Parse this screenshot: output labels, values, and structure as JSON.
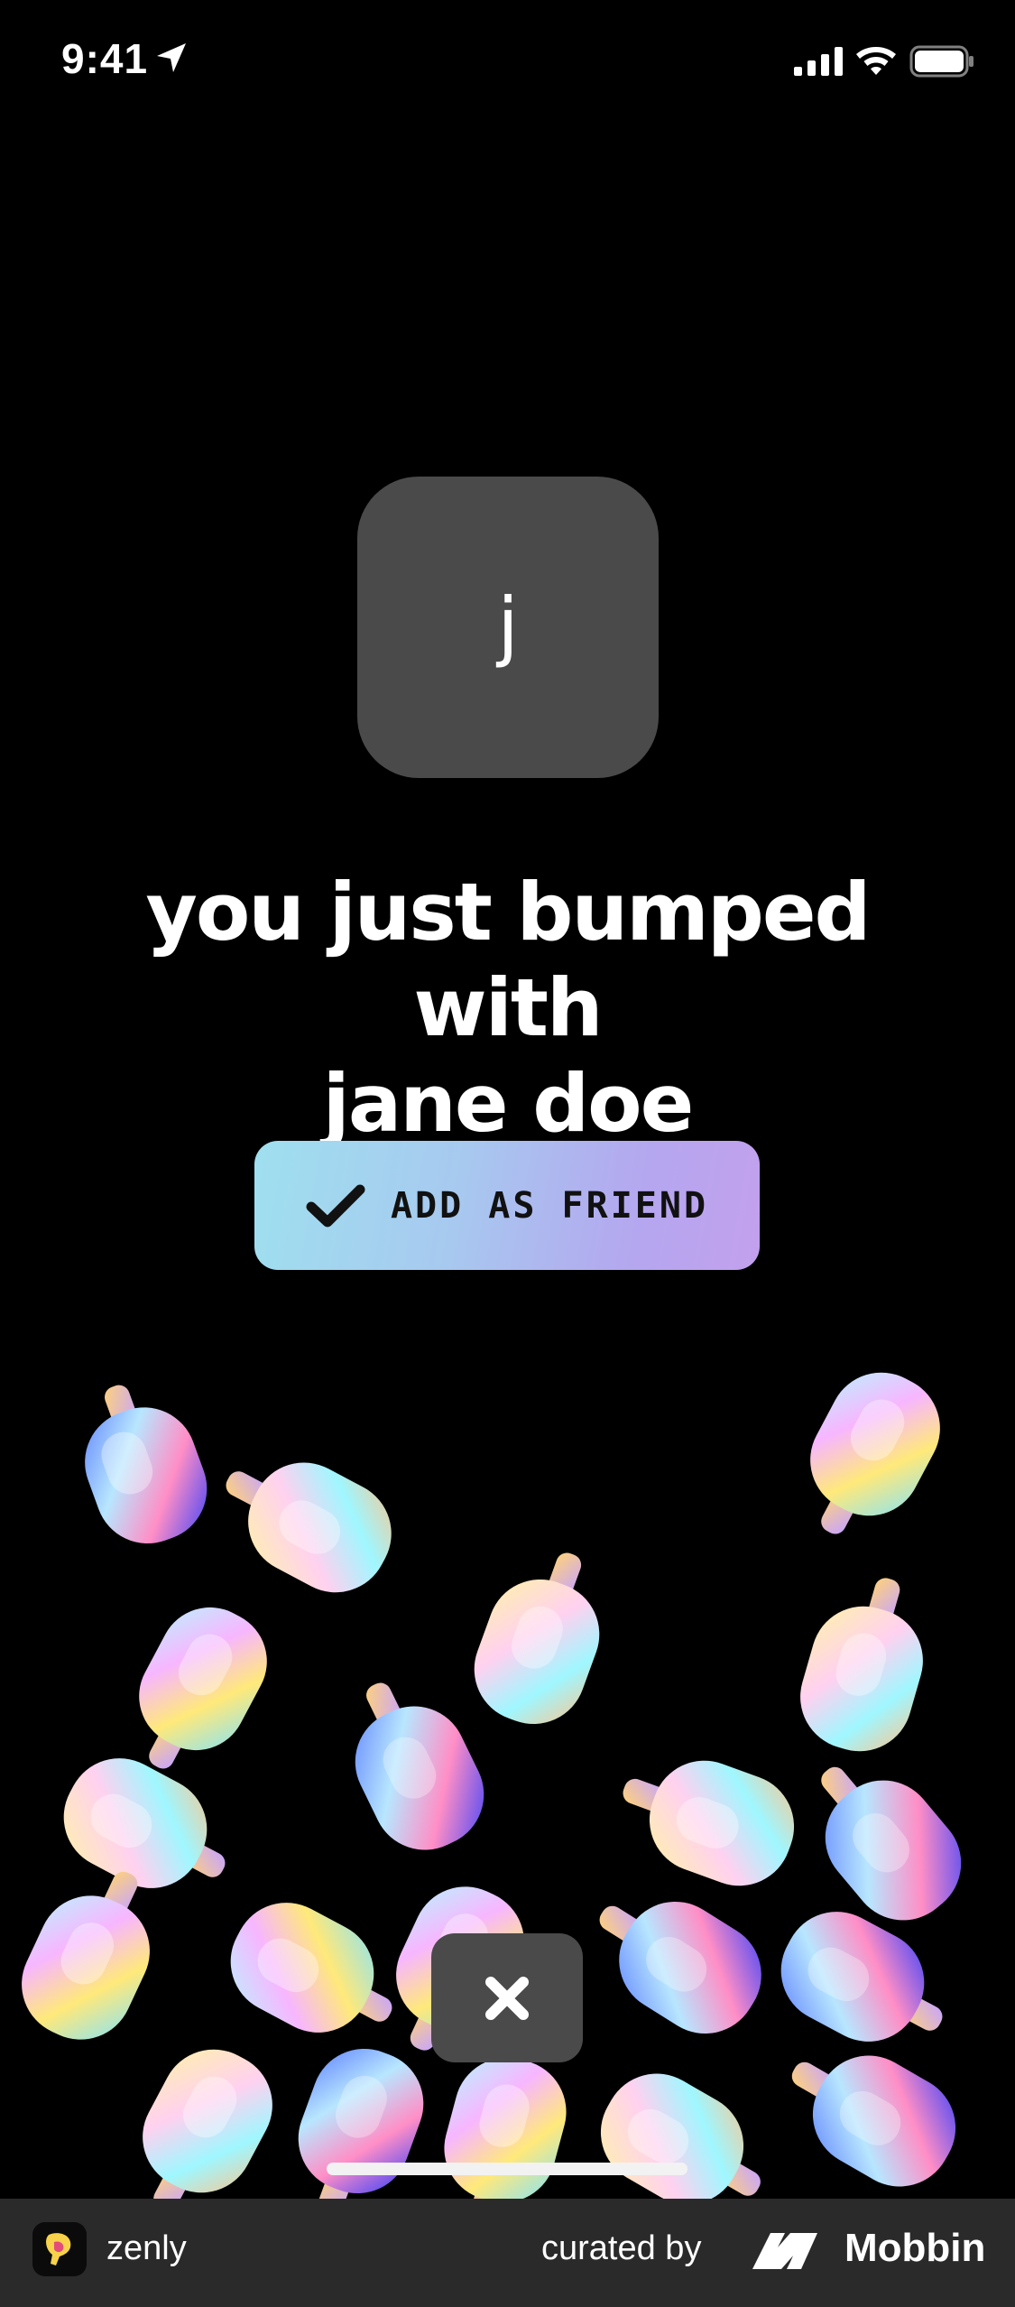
{
  "status_bar": {
    "time": "9:41"
  },
  "profile": {
    "avatar_letter": "j",
    "headline_line1": "you just bumped with",
    "headline_line2": "jane doe"
  },
  "actions": {
    "add_friend_label": "ADD AS FRIEND"
  },
  "footer": {
    "app_name": "zenly",
    "curated_by": "curated by",
    "brand": "Mobbin"
  },
  "colors": {
    "background": "#000000",
    "avatar_bg": "#4a4a4a",
    "button_gradient_start": "#9fe0ef",
    "button_gradient_end": "#c3a0ee",
    "close_bg": "#4a4a4a",
    "footer_bg": "#2a2a2a"
  },
  "icons": {
    "location": "location-arrow-icon",
    "signal": "cellular-signal-icon",
    "wifi": "wifi-icon",
    "battery": "battery-icon",
    "check": "checkmark-icon",
    "close": "close-icon",
    "app": "zenly-app-icon",
    "brand": "mobbin-logo-icon"
  }
}
